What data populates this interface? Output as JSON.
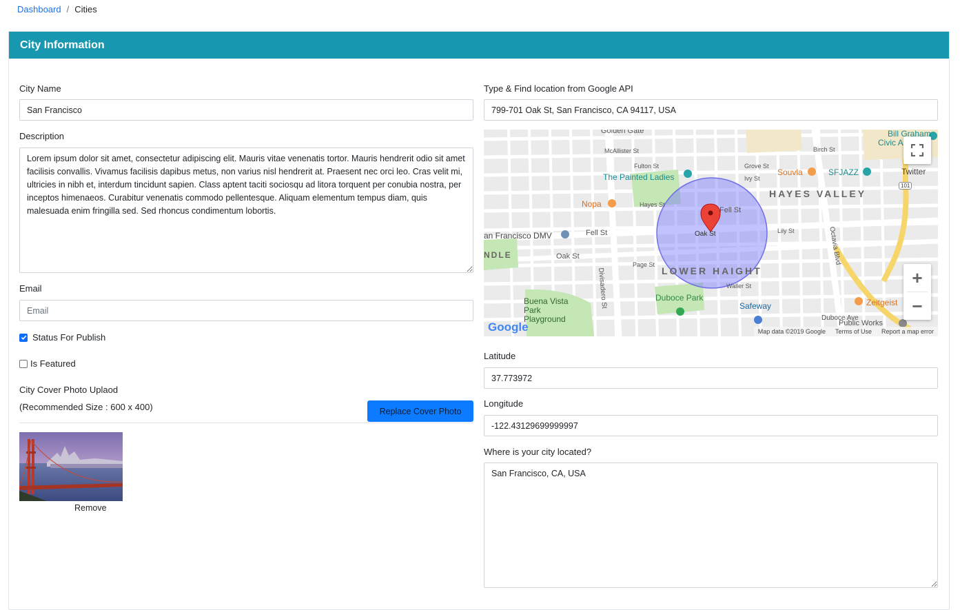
{
  "breadcrumb": {
    "home": "Dashboard",
    "separator": "/",
    "current": "Cities"
  },
  "card": {
    "title": "City Information"
  },
  "form": {
    "city_name_label": "City Name",
    "city_name_value": "San Francisco",
    "description_label": "Description",
    "description_value": "Lorem ipsum dolor sit amet, consectetur adipiscing elit. Mauris vitae venenatis tortor. Mauris hendrerit odio sit amet facilisis convallis. Vivamus facilisis dapibus metus, non varius nisl hendrerit at. Praesent nec orci leo. Cras velit mi, ultricies in nibh et, interdum tincidunt sapien. Class aptent taciti sociosqu ad litora torquent per conubia nostra, per inceptos himenaeos. Curabitur venenatis commodo pellentesque. Aliquam elementum tempus diam, quis malesuada enim fringilla sed. Sed rhoncus condimentum lobortis.",
    "email_label": "Email",
    "email_placeholder": "Email",
    "status_label": "Status For Publish",
    "status_checked": true,
    "featured_label": "Is Featured",
    "featured_checked": false,
    "cover_label": "City Cover Photo Uplaod",
    "cover_hint": "(Recommended Size : 600 x 400)",
    "replace_button": "Replace Cover Photo",
    "remove_label": "Remove",
    "location_label": "Type & Find location from Google API",
    "location_value": "799-701 Oak St, San Francisco, CA 94117, USA",
    "latitude_label": "Latitude",
    "latitude_value": "37.773972",
    "longitude_label": "Longitude",
    "longitude_value": "-122.43129699999997",
    "where_label": "Where is your city located?",
    "where_value": "San Francisco, CA, USA"
  },
  "map": {
    "labels": {
      "golden_gate": "Golden Gate",
      "mcallister": "McAllister St",
      "fulton": "Fulton St",
      "painted_ladies": "The Painted Ladies",
      "nopa": "Nopa",
      "hayes": "Hayes St",
      "fell": "Fell St",
      "oak": "Oak St",
      "sf_dmv": "an Francisco DMV",
      "ndle": "NDLE",
      "lower_haight": "LOWER HAIGHT",
      "hayes_valley": "HAYES VALLEY",
      "souvla": "Souvla",
      "sfjazz": "SFJAZZ",
      "bill_graham": "Bill Graham",
      "civic": "Civic Audito",
      "twitter": "Twitter",
      "duboce_park": "Duboce Park",
      "buena_vista": "Buena Vista Park Playground",
      "safeway": "Safeway",
      "zeitgeist": "Zeitgeist",
      "duboce_ave": "Duboce Ave",
      "divisadero": "Divisadero St",
      "octavia": "Octavia Blvd",
      "page": "Page St",
      "waller": "Waller St",
      "grove": "Grove St",
      "birch": "Birch St",
      "ivy": "Ivy St",
      "lily": "Lily St",
      "public_works": "Public Works",
      "hwy": "101"
    },
    "footer": {
      "data": "Map data ©2019 Google",
      "terms": "Terms of Use",
      "report": "Report a map error"
    },
    "brand": "Google",
    "zoom_in": "+",
    "zoom_out": "−"
  }
}
